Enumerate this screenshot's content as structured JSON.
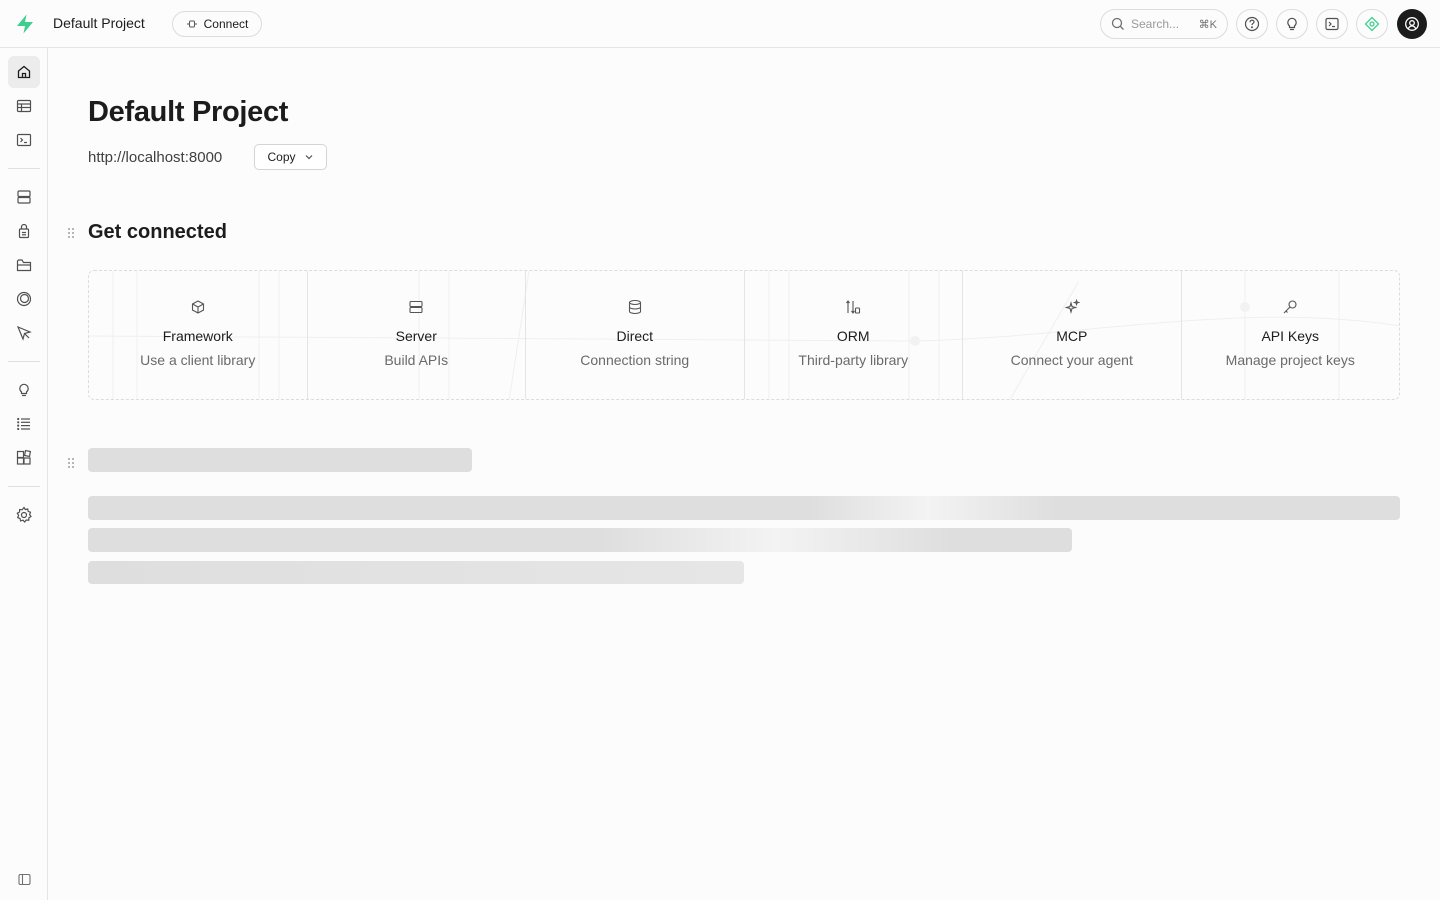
{
  "header": {
    "project_name": "Default Project",
    "connect_label": "Connect",
    "search_placeholder": "Search...",
    "search_shortcut": "⌘K",
    "brand_color": "#3ecf8e"
  },
  "sidebar": {
    "items": [
      {
        "name": "home-icon",
        "active": true
      },
      {
        "name": "table-editor-icon"
      },
      {
        "name": "sql-editor-icon"
      },
      {
        "name": "database-icon"
      },
      {
        "name": "auth-icon"
      },
      {
        "name": "storage-icon"
      },
      {
        "name": "realtime-icon"
      },
      {
        "name": "edge-functions-icon"
      },
      {
        "name": "advisors-icon"
      },
      {
        "name": "logs-icon"
      },
      {
        "name": "integrations-icon"
      },
      {
        "name": "settings-icon"
      }
    ]
  },
  "main": {
    "title": "Default Project",
    "url": "http://localhost:8000",
    "copy_label": "Copy",
    "section_title": "Get connected",
    "cards": [
      {
        "icon": "package-icon",
        "title": "Framework",
        "subtitle": "Use a client library"
      },
      {
        "icon": "server-icon",
        "title": "Server",
        "subtitle": "Build APIs"
      },
      {
        "icon": "database-icon",
        "title": "Direct",
        "subtitle": "Connection string"
      },
      {
        "icon": "orm-icon",
        "title": "ORM",
        "subtitle": "Third-party library"
      },
      {
        "icon": "sparkles-icon",
        "title": "MCP",
        "subtitle": "Connect your agent"
      },
      {
        "icon": "key-icon",
        "title": "API Keys",
        "subtitle": "Manage project keys"
      }
    ]
  }
}
